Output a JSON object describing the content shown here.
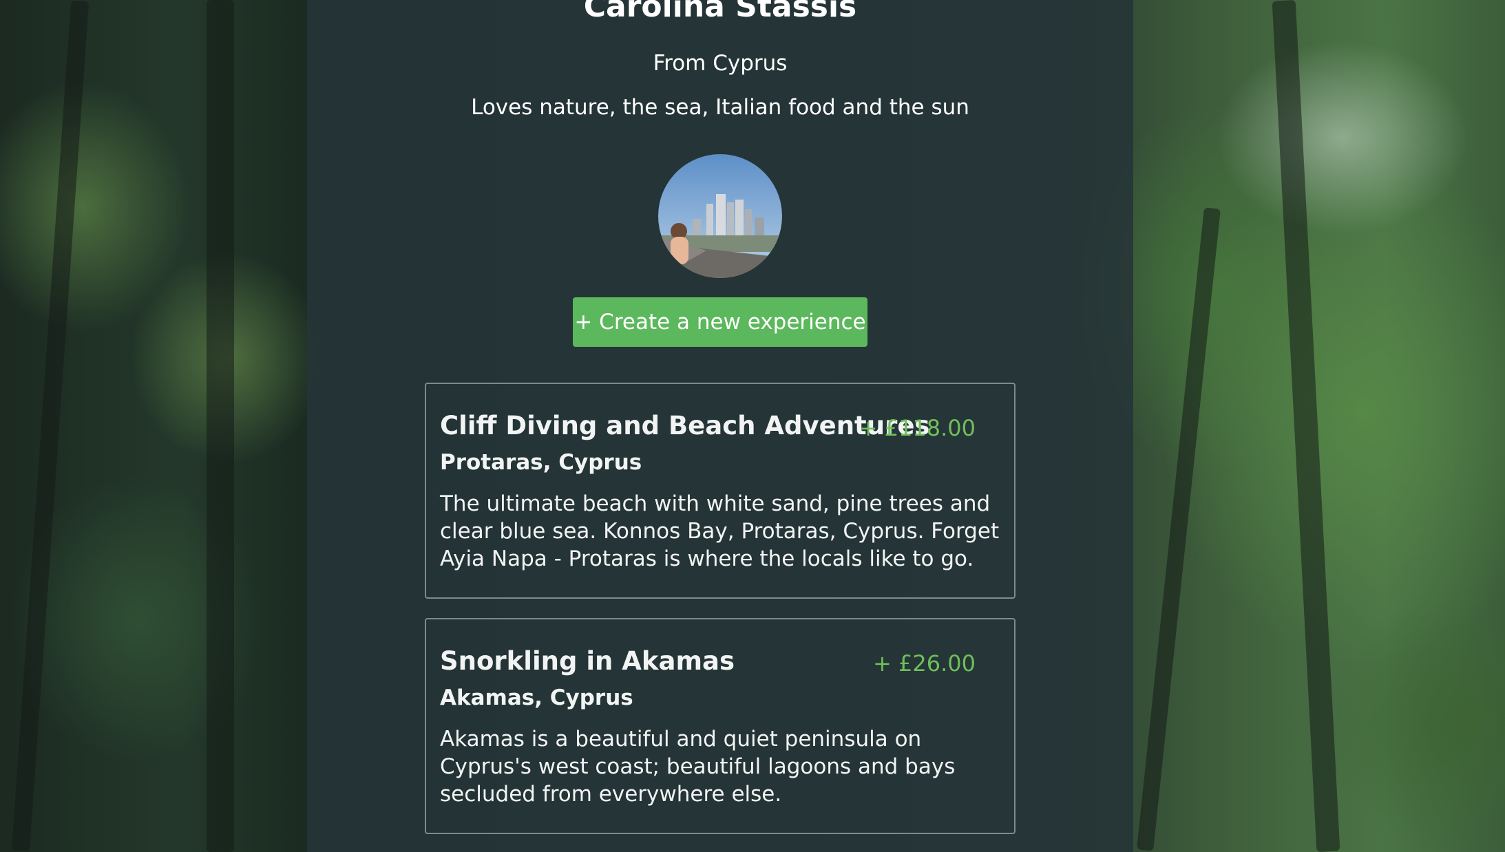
{
  "profile": {
    "name": "Carolina Stassis",
    "origin": "From Cyprus",
    "bio": "Loves nature, the sea, Italian food and the sun"
  },
  "actions": {
    "create_label": "+ Create a new experience"
  },
  "experiences": [
    {
      "title": "Cliff Diving and Beach Adventures",
      "price": "+ £118.00",
      "location": "Protaras, Cyprus",
      "description": "The ultimate beach with white sand, pine trees and clear blue sea. Konnos Bay, Protaras, Cyprus. Forget Ayia Napa - Protaras is where the locals like to go."
    },
    {
      "title": "Snorkling in Akamas",
      "price": "+ £26.00",
      "location": "Akamas, Cyprus",
      "description": "Akamas is a beautiful and quiet peninsula on Cyprus's west coast; beautiful lagoons and bays secluded from everywhere else."
    }
  ],
  "colors": {
    "accent": "#5cb85c",
    "price": "#6fbf5a",
    "panel": "#263438"
  }
}
